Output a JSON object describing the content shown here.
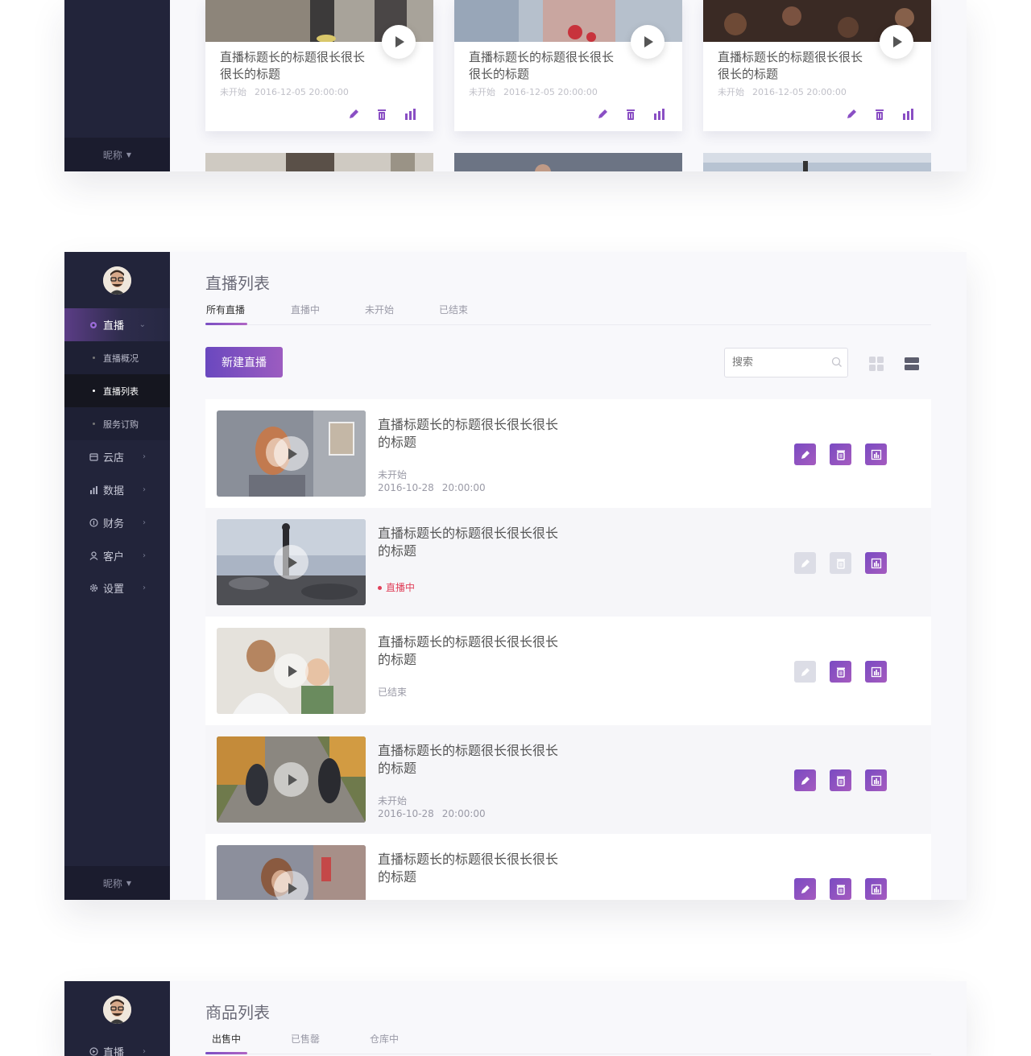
{
  "panel_top": {
    "footer_nickname": "昵称",
    "cards": [
      {
        "title": "直播标题长的标题很长很长很长的标题",
        "status": "未开始",
        "datetime": "2016-12-05 20:00:00"
      },
      {
        "title": "直播标题长的标题很长很长很长的标题",
        "status": "未开始",
        "datetime": "2016-12-05 20:00:00"
      },
      {
        "title": "直播标题长的标题很长很长很长的标题",
        "status": "未开始",
        "datetime": "2016-12-05 20:00:00"
      }
    ]
  },
  "panel_live": {
    "sidebar": {
      "menu": [
        {
          "label": "直播",
          "icon": "live-dot-icon"
        },
        {
          "label": "云店",
          "icon": "store-icon"
        },
        {
          "label": "数据",
          "icon": "chart-icon"
        },
        {
          "label": "财务",
          "icon": "finance-icon"
        },
        {
          "label": "客户",
          "icon": "user-icon"
        },
        {
          "label": "设置",
          "icon": "gear-icon"
        }
      ],
      "submenu": [
        {
          "label": "直播概况"
        },
        {
          "label": "直播列表"
        },
        {
          "label": "服务订购"
        }
      ],
      "footer_nickname": "昵称"
    },
    "page_title": "直播列表",
    "tabs": [
      {
        "label": "所有直播"
      },
      {
        "label": "直播中"
      },
      {
        "label": "未开始"
      },
      {
        "label": "已结束"
      }
    ],
    "new_button": "新建直播",
    "search_placeholder": "搜索",
    "rows": [
      {
        "title": "直播标题长的标题很长很长很长的标题",
        "status": "未开始",
        "date": "2016-10-28",
        "time": "20:00:00"
      },
      {
        "title": "直播标题长的标题很长很长很长的标题",
        "status": "直播中"
      },
      {
        "title": "直播标题长的标题很长很长很长的标题",
        "status": "已结束"
      },
      {
        "title": "直播标题长的标题很长很长很长的标题",
        "status": "未开始",
        "date": "2016-10-28",
        "time": "20:00:00"
      },
      {
        "title": "直播标题长的标题很长很长很长的标题"
      }
    ],
    "colors": {
      "accent": "#7a4bc2",
      "live": "#e0405a",
      "sidebar": "#22243a"
    }
  },
  "panel_goods": {
    "page_title": "商品列表",
    "tabs": [
      {
        "label": "出售中"
      },
      {
        "label": "已售罄"
      },
      {
        "label": "仓库中"
      }
    ],
    "sidebar_first_item": "直播"
  }
}
